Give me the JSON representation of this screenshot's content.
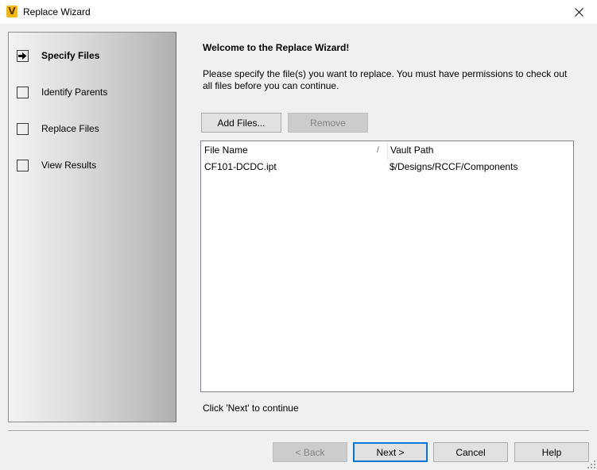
{
  "window": {
    "title": "Replace Wizard",
    "app_icon_glyph": "V",
    "app_icon_color": "#f5b90f"
  },
  "sidebar": {
    "steps": [
      {
        "label": "Specify Files",
        "state": "current"
      },
      {
        "label": "Identify Parents",
        "state": "pending"
      },
      {
        "label": "Replace Files",
        "state": "pending"
      },
      {
        "label": "View Results",
        "state": "pending"
      }
    ]
  },
  "main": {
    "heading": "Welcome to the Replace Wizard!",
    "instructions": "Please specify the file(s) you want to replace. You must have permissions to check out all files before you can continue.",
    "add_files_label": "Add Files...",
    "remove_label": "Remove",
    "table": {
      "columns": [
        "File Name",
        "Vault Path"
      ],
      "sort_indicator": "/",
      "rows": [
        {
          "file_name": "CF101-DCDC.ipt",
          "vault_path": "$/Designs/RCCF/Components"
        }
      ]
    },
    "hint": "Click 'Next' to continue"
  },
  "footer": {
    "back_label": "< Back",
    "next_label": "Next >",
    "cancel_label": "Cancel",
    "help_label": "Help"
  }
}
